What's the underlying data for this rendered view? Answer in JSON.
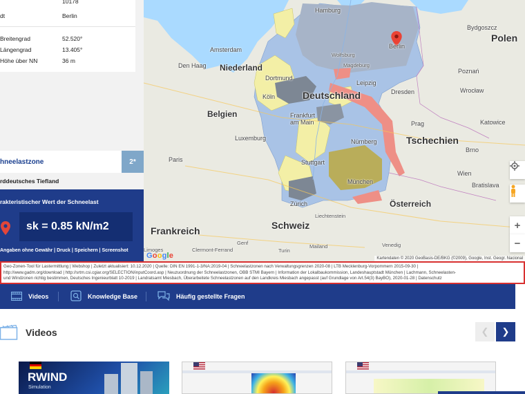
{
  "location": {
    "top_value": "10178",
    "city_label_fragment": "dt",
    "city_value": "Berlin",
    "rows": [
      {
        "label": "Breitengrad",
        "value": "52.520°"
      },
      {
        "label": "Längengrad",
        "value": "13.405°"
      },
      {
        "label": "Höhe über NN",
        "value": "36 m"
      }
    ]
  },
  "zone_tab": {
    "label": "hneelastzone",
    "badge": "2*"
  },
  "zone_name": "rddeutsches Tiefland",
  "snow_load": {
    "title": "rakteristischer Wert der Schneelast",
    "value": "sk = 0.85 kN/m2",
    "links": "Angaben ohne Gewähr | Druck | Speichern | Screenshot"
  },
  "map": {
    "labels": {
      "hamburg": "Hamburg",
      "bydgoszcz": "Bydgoszcz",
      "polen": "Polen",
      "amsterdam": "Amsterdam",
      "berlin": "Berlin",
      "wolfsburg": "Wolfsburg",
      "denhaag": "Den Haag",
      "niederland": "Niederland",
      "magdeburg": "Magdeburg",
      "poznan": "Poznań",
      "dortmund": "Dortmund",
      "leipzig": "Leipzig",
      "wroclaw": "Wrocław",
      "koln": "Köln",
      "deutschland": "Deutschland",
      "dresden": "Dresden",
      "belgien": "Belgien",
      "frankfurt": "Frankfurt am Main",
      "katowice": "Katowice",
      "luxemburg": "Luxemburg",
      "prag": "Prag",
      "tschechien": "Tschechien",
      "nurnberg": "Nürnberg",
      "brno": "Brno",
      "paris": "Paris",
      "stuttgart": "Stuttgart",
      "munchen": "München",
      "wien": "Wien",
      "bratislava": "Bratislava",
      "osterreich": "Österreich",
      "zurich": "Zürich",
      "liechtenstein": "Liechtenstein",
      "frankreich": "Frankreich",
      "schweiz": "Schweiz",
      "limoges": "Limoges",
      "clermont": "Clermont-Ferrand",
      "genf": "Genf",
      "mailand": "Mailand",
      "venedig": "Venedig",
      "turin": "Turin"
    },
    "google": [
      "G",
      "o",
      "o",
      "g",
      "l",
      "e"
    ],
    "google_colors": [
      "#4285F4",
      "#EA4335",
      "#FBBC05",
      "#4285F4",
      "#34A853",
      "#EA4335"
    ],
    "attribution": "Kartendaten © 2020 GeoBasis-DE/BKG (©2009), Google, Inst. Geogr. Nacional",
    "zoom_in": "+",
    "zoom_out": "−"
  },
  "sources": {
    "line1": "Geo-Zonen-Tool für Lastermittlung | Webshop | Zuletzt aktualisiert: 10.12.2020 | Quelle: DIN EN 1991-1-3/NA:2019-04 | Schneelastzonen nach Verwaltungsgrenzen 2020-08 | LTB Mecklenburg-Vorpommern 2015-09-30 |",
    "line2": "http://www.gadm.org/download | http://srtm.csi.cgiar.org/SELECTION/inputCoord.asp | Neuzuordnung der Schneelastzonen, OBB STMI Bayern | Information der Lokalbaukommission, Landeshauptstadt München | Lachmann, Schneelasten-",
    "line3": "und Windzonen richtig bestimmen, Deutsches Ingenieurblatt 10-2019 | Landratsamt Miesbach, Überarbeitete Schneelastzonen auf den Landkreis Miesbach angepasst (auf Grundlage von Art.54(3) BayBO), 2020-01-28 | Datenschutz"
  },
  "nav": {
    "videos": "Videos",
    "knowledge_base": "Knowledge Base",
    "faq": "Häufig gestellte Fragen"
  },
  "videos_section": {
    "title": "Videos",
    "prev": "❮",
    "next": "❯",
    "thumb1_title": "RWIND",
    "thumb1_subtitle": "Simulation"
  },
  "colors": {
    "navy": "#1f3c8a",
    "zone_blue": "#a9c3e6",
    "zone_yellow": "#f3efa6",
    "zone_red": "#ee8f86",
    "zone_dark": "#7d8794",
    "highlight_border": "#d83030"
  }
}
